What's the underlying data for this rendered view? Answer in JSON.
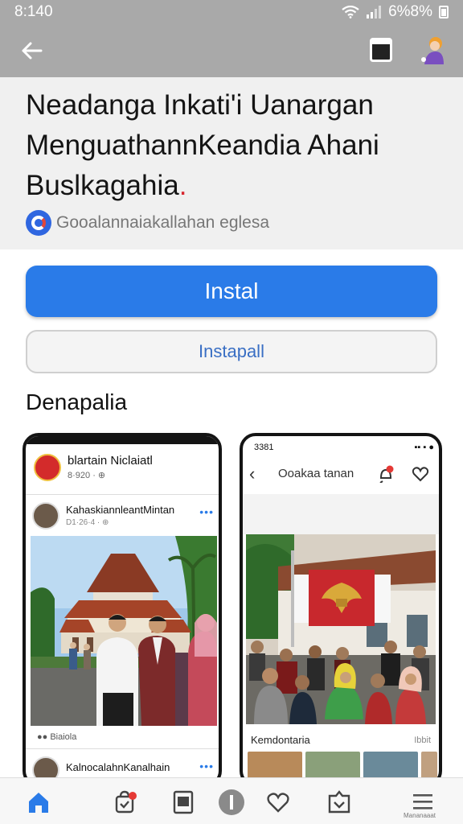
{
  "status_bar": {
    "time": "8:140",
    "battery": "6%8%"
  },
  "app_bar": {
    "back_icon": "arrow-left-icon",
    "tabs_icon": "tabs-icon",
    "profile_icon": "avatar-icon"
  },
  "header": {
    "title_line1": "Neadanga Inkati'i Uanargan",
    "title_line2": "MenguathannKeandia Ahani",
    "title_line3": "Buslkagahia",
    "title_dot": ".",
    "publisher": "Gooalannaiakallahan eglesa"
  },
  "actions": {
    "install_label": "Instal",
    "secondary_label": "Instapall"
  },
  "section": {
    "heading": "Denapalia"
  },
  "screenshot_left": {
    "page_name": "blartain Niclaiatl",
    "page_sub": "8·920 · ⊕",
    "post_author": "KahaskiannleantMintan",
    "post_meta": "D1·26·4 · ⊕",
    "post_more": "•••",
    "caption": "●● Biaiola",
    "post2_author": "KalnocalahnKanalhain",
    "post2_more": "•••"
  },
  "screenshot_right": {
    "time": "3381",
    "signal": "▪▪ ▪ ●",
    "title": "Ooakaa tanan",
    "caption": "Kemdontaria",
    "caption_right": "Ibbit"
  },
  "bottom_nav": {
    "items": [
      "home-icon",
      "shopping-bag-icon",
      "tablet-icon",
      "info-icon",
      "heart-icon",
      "inbox-icon",
      "menu-icon"
    ],
    "menu_label": "Mananaaat"
  },
  "colors": {
    "accent": "#2a7be8",
    "bar": "#a9a9a9",
    "flag_red": "#c8282d"
  }
}
